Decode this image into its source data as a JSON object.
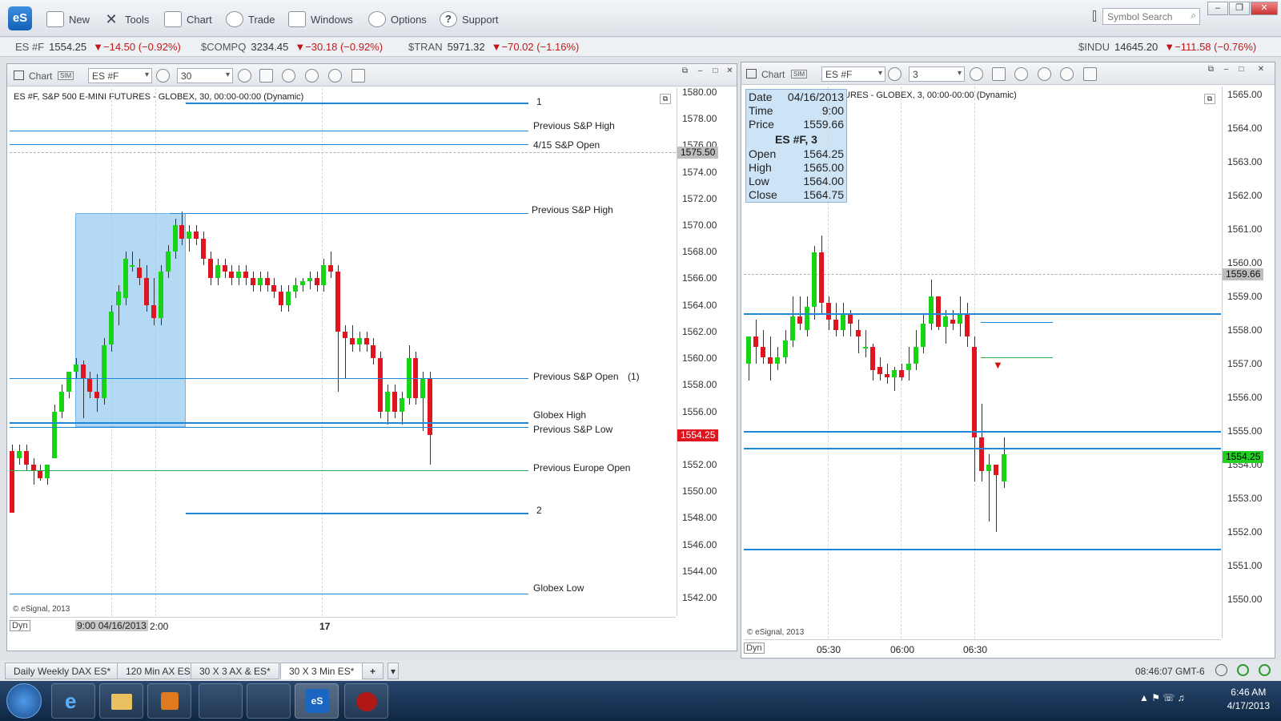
{
  "app": {
    "logo": "eS",
    "menu": [
      "New",
      "Tools",
      "Chart",
      "Trade",
      "Windows",
      "Options",
      "Support"
    ],
    "search_placeholder": "Symbol Search"
  },
  "ticker": [
    {
      "sym": "ES #F",
      "price": "1554.25",
      "chg": "▼−14.50 (−0.92%)"
    },
    {
      "sym": "$COMPQ",
      "price": "3234.45",
      "chg": "▼−30.18 (−0.92%)"
    },
    {
      "sym": "$TRAN",
      "price": "5971.32",
      "chg": "▼−70.02 (−1.16%)"
    },
    {
      "sym": "$INDU",
      "price": "14645.20",
      "chg": "▼−111.58 (−0.76%)"
    }
  ],
  "colors": {
    "up": "#17d417",
    "down": "#e0141e",
    "level": "#1d88d8",
    "box": "#8cc6f0"
  },
  "left_chart": {
    "title": "Chart",
    "symbol": "ES #F",
    "interval": "30",
    "caption": "ES #F, S&P 500 E-MINI FUTURES - GLOBEX, 30, 00:00-00:00 (Dynamic)",
    "y_ticks": [
      "1580.00",
      "1578.00",
      "1576.00",
      "1574.00",
      "1572.00",
      "1570.00",
      "1568.00",
      "1566.00",
      "1564.00",
      "1562.00",
      "1560.00",
      "1558.00",
      "1556.00",
      "1554.00",
      "1552.00",
      "1550.00",
      "1548.00",
      "1546.00",
      "1544.00",
      "1542.00"
    ],
    "price_tag_gray": "1575.50",
    "price_tag_last": "1554.25",
    "levels": [
      {
        "label": "1",
        "price": 1579.2
      },
      {
        "label": "Previous S&P High",
        "price": 1577.1
      },
      {
        "label": "4/15 S&P Open",
        "price": 1576.1
      },
      {
        "label": "Previous S&P High",
        "price": 1570.9
      },
      {
        "label": "Previous S&P Open",
        "price": 1558.5,
        "extra": "(1)"
      },
      {
        "label": "Globex High",
        "price": 1555.2
      },
      {
        "label": "Previous S&P Low",
        "price": 1554.8
      },
      {
        "label": "Previous Europe Open",
        "price": 1551.6
      },
      {
        "label": "2",
        "price": 1548.4
      },
      {
        "label": "Globex Low",
        "price": 1542.3
      }
    ],
    "x_labels": [
      "9:00 04/16/2013",
      "2:00",
      "17"
    ],
    "copyright": "© eSignal, 2013",
    "dyn": "Dyn",
    "candles": [
      [
        1553.0,
        1553.5,
        1548.4,
        1548.4
      ],
      [
        1552.5,
        1553.5,
        1552.0,
        1553.0
      ],
      [
        1553.0,
        1553.5,
        1551.5,
        1552.0
      ],
      [
        1552.0,
        1552.5,
        1550.5,
        1551.5
      ],
      [
        1551.5,
        1552.0,
        1550.8,
        1551.0
      ],
      [
        1551.0,
        1552.0,
        1550.5,
        1552.0
      ],
      [
        1552.5,
        1556.5,
        1552.5,
        1556.0
      ],
      [
        1556.0,
        1558.0,
        1555.5,
        1557.5
      ],
      [
        1557.5,
        1559.0,
        1557.0,
        1559.0
      ],
      [
        1559.0,
        1560.0,
        1558.5,
        1559.5
      ],
      [
        1559.5,
        1559.8,
        1555.5,
        1558.5
      ],
      [
        1558.5,
        1559.0,
        1557.0,
        1557.5
      ],
      [
        1557.5,
        1558.8,
        1556.0,
        1557.0
      ],
      [
        1557.0,
        1561.5,
        1556.5,
        1561.0
      ],
      [
        1561.0,
        1564.0,
        1560.5,
        1563.5
      ],
      [
        1564.0,
        1565.5,
        1562.5,
        1565.0
      ],
      [
        1564.5,
        1568.0,
        1564.0,
        1567.5
      ],
      [
        1567.0,
        1568.0,
        1566.5,
        1567.0
      ],
      [
        1566.8,
        1567.5,
        1565.5,
        1566.0
      ],
      [
        1566.0,
        1567.0,
        1563.5,
        1564.0
      ],
      [
        1564.0,
        1566.0,
        1562.5,
        1563.0
      ],
      [
        1563.0,
        1567.0,
        1562.5,
        1566.5
      ],
      [
        1566.5,
        1568.5,
        1566.0,
        1568.0
      ],
      [
        1568.0,
        1570.5,
        1567.5,
        1570.0
      ],
      [
        1570.0,
        1571.0,
        1568.5,
        1569.0
      ],
      [
        1569.0,
        1570.0,
        1568.0,
        1569.5
      ],
      [
        1569.5,
        1570.0,
        1568.5,
        1569.0
      ],
      [
        1569.0,
        1569.5,
        1567.0,
        1567.5
      ],
      [
        1567.5,
        1568.0,
        1565.5,
        1566.0
      ],
      [
        1566.0,
        1567.5,
        1565.5,
        1567.0
      ],
      [
        1567.0,
        1567.5,
        1566.0,
        1566.5
      ],
      [
        1566.5,
        1567.0,
        1565.5,
        1566.0
      ],
      [
        1566.0,
        1567.0,
        1565.5,
        1566.5
      ],
      [
        1566.5,
        1567.0,
        1565.5,
        1566.0
      ],
      [
        1566.0,
        1566.5,
        1565.0,
        1565.5
      ],
      [
        1565.5,
        1566.5,
        1565.0,
        1566.0
      ],
      [
        1566.0,
        1566.5,
        1565.0,
        1565.5
      ],
      [
        1565.5,
        1566.0,
        1564.5,
        1565.0
      ],
      [
        1565.0,
        1565.5,
        1563.5,
        1564.0
      ],
      [
        1564.0,
        1565.5,
        1563.5,
        1565.0
      ],
      [
        1565.0,
        1566.0,
        1564.5,
        1565.5
      ],
      [
        1565.5,
        1566.0,
        1565.0,
        1565.8
      ],
      [
        1565.8,
        1566.5,
        1565.2,
        1566.0
      ],
      [
        1566.0,
        1566.5,
        1565.0,
        1565.5
      ],
      [
        1565.5,
        1567.5,
        1565.0,
        1567.0
      ],
      [
        1567.0,
        1568.0,
        1566.0,
        1566.5
      ],
      [
        1566.5,
        1567.0,
        1557.5,
        1562.0
      ],
      [
        1562.0,
        1562.5,
        1558.5,
        1561.5
      ],
      [
        1561.5,
        1562.5,
        1560.5,
        1561.0
      ],
      [
        1561.0,
        1562.0,
        1560.5,
        1561.5
      ],
      [
        1561.5,
        1562.0,
        1560.5,
        1561.0
      ],
      [
        1561.0,
        1561.5,
        1559.5,
        1560.0
      ],
      [
        1560.0,
        1560.5,
        1555.5,
        1556.0
      ],
      [
        1556.0,
        1558.0,
        1555.0,
        1557.5
      ],
      [
        1557.5,
        1558.0,
        1555.5,
        1556.0
      ],
      [
        1556.0,
        1557.5,
        1555.0,
        1557.0
      ],
      [
        1557.0,
        1561.0,
        1556.5,
        1560.0
      ],
      [
        1560.0,
        1560.5,
        1556.5,
        1557.0
      ],
      [
        1557.0,
        1559.0,
        1554.5,
        1558.5
      ],
      [
        1558.5,
        1559.0,
        1552.0,
        1554.25
      ]
    ]
  },
  "right_chart": {
    "title": "Chart",
    "symbol": "ES #F",
    "interval": "3",
    "caption": "URES - GLOBEX, 3, 00:00-00:00 (Dynamic)",
    "y_ticks": [
      "1565.00",
      "1564.00",
      "1563.00",
      "1562.00",
      "1561.00",
      "1560.00",
      "1559.00",
      "1558.00",
      "1557.00",
      "1556.00",
      "1555.00",
      "1554.00",
      "1553.00",
      "1552.00",
      "1551.00",
      "1550.00"
    ],
    "price_tag_gray": "1559.66",
    "price_tag_last": "1554.25",
    "data_window": {
      "rows1": [
        [
          "Date",
          "04/16/2013"
        ],
        [
          "Time",
          "9:00"
        ],
        [
          "Price",
          "1559.66"
        ]
      ],
      "heading": "ES #F, 3",
      "rows2": [
        [
          "Open",
          "1564.25"
        ],
        [
          "High",
          "1565.00"
        ],
        [
          "Low",
          "1564.00"
        ],
        [
          "Close",
          "1564.75"
        ]
      ]
    },
    "x_labels": [
      "05:30",
      "06:00",
      "06:30"
    ],
    "copyright": "© eSignal, 2013",
    "dyn": "Dyn",
    "candles": [
      [
        1557.0,
        1557.6,
        1556.5,
        1557.8
      ],
      [
        1557.8,
        1558.3,
        1557.0,
        1557.5
      ],
      [
        1557.5,
        1558.0,
        1557.0,
        1557.2
      ],
      [
        1557.2,
        1557.8,
        1556.5,
        1557.0
      ],
      [
        1557.0,
        1557.5,
        1556.8,
        1557.2
      ],
      [
        1557.2,
        1558.0,
        1557.0,
        1557.7
      ],
      [
        1557.7,
        1559.0,
        1557.5,
        1558.4
      ],
      [
        1558.4,
        1559.0,
        1558.0,
        1558.2
      ],
      [
        1558.0,
        1559.0,
        1557.8,
        1558.7
      ],
      [
        1558.7,
        1560.5,
        1558.3,
        1560.3
      ],
      [
        1560.3,
        1560.8,
        1558.5,
        1558.8
      ],
      [
        1558.8,
        1559.0,
        1558.0,
        1558.3
      ],
      [
        1558.3,
        1558.8,
        1557.8,
        1558.0
      ],
      [
        1558.0,
        1558.8,
        1557.8,
        1558.5
      ],
      [
        1558.5,
        1558.6,
        1557.8,
        1558.2
      ],
      [
        1558.0,
        1558.3,
        1557.3,
        1557.8
      ],
      [
        1557.5,
        1558.0,
        1557.2,
        1557.5
      ],
      [
        1557.5,
        1557.6,
        1556.5,
        1556.8
      ],
      [
        1556.9,
        1557.2,
        1556.5,
        1556.7
      ],
      [
        1556.7,
        1557.0,
        1556.4,
        1556.6
      ],
      [
        1556.6,
        1556.9,
        1556.2,
        1556.8
      ],
      [
        1556.8,
        1557.0,
        1556.5,
        1556.6
      ],
      [
        1556.8,
        1557.5,
        1556.5,
        1557.0
      ],
      [
        1557.0,
        1558.0,
        1556.8,
        1557.5
      ],
      [
        1557.5,
        1558.5,
        1557.3,
        1558.2
      ],
      [
        1558.2,
        1559.5,
        1558.0,
        1559.0
      ],
      [
        1559.0,
        1559.0,
        1558.0,
        1558.1
      ],
      [
        1558.1,
        1558.6,
        1557.6,
        1558.4
      ],
      [
        1558.3,
        1558.6,
        1558.0,
        1558.2
      ],
      [
        1558.2,
        1559.0,
        1557.8,
        1558.5
      ],
      [
        1558.5,
        1558.8,
        1557.5,
        1557.8
      ],
      [
        1557.5,
        1557.8,
        1553.5,
        1554.8
      ],
      [
        1554.8,
        1555.8,
        1553.5,
        1553.8
      ],
      [
        1553.8,
        1554.3,
        1552.3,
        1554.0
      ],
      [
        1554.0,
        1554.0,
        1552.0,
        1553.7
      ],
      [
        1553.5,
        1554.8,
        1553.3,
        1554.3
      ]
    ]
  },
  "tabs": [
    "Daily Weekly DAX ES*",
    "120 Min AX ES",
    "30 X 3 AX & ES*",
    "30 X 3 Min ES*",
    "+"
  ],
  "status_time": "08:46:07 GMT-6",
  "taskbar": {
    "time": "6:46 AM",
    "date": "4/17/2013"
  }
}
